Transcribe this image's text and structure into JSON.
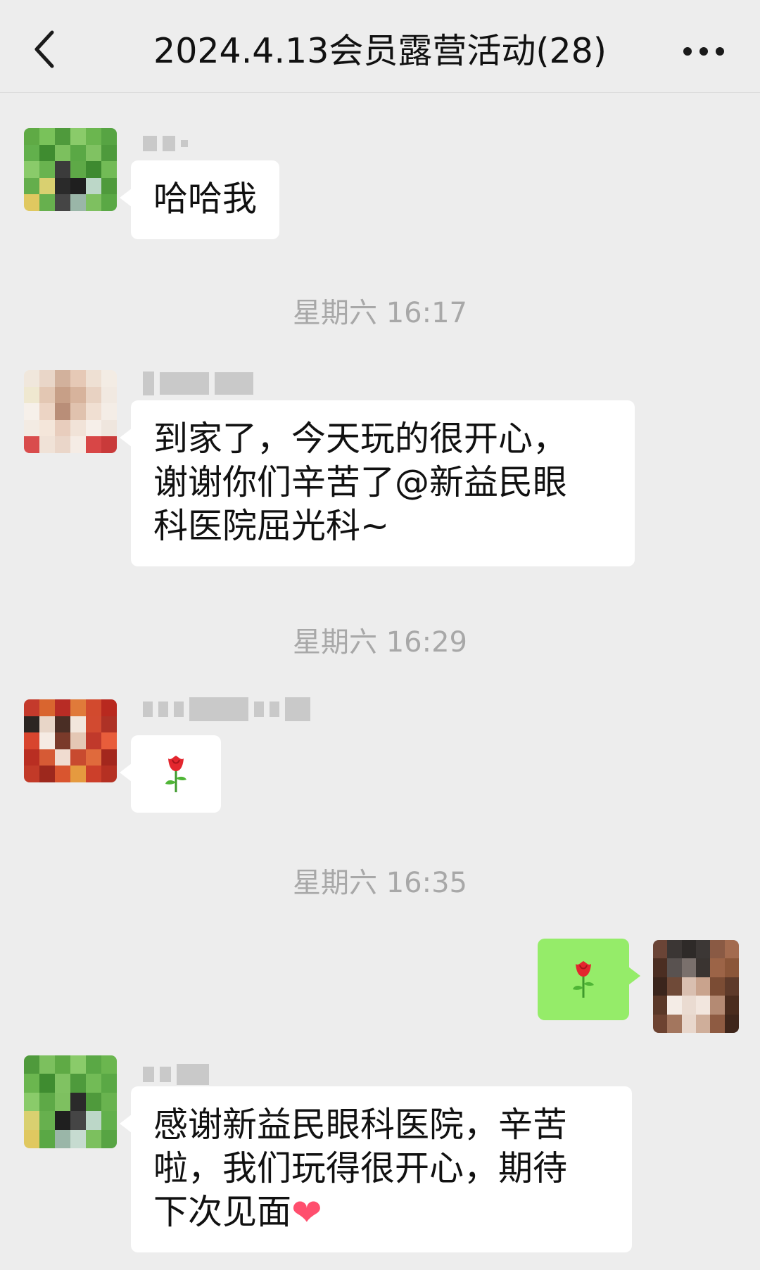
{
  "header": {
    "title": "2024.4.13会员露营活动(28)",
    "back_icon": "chevron-left-icon",
    "more_icon": "ellipsis-icon"
  },
  "messages": [
    {
      "type": "text",
      "sender": "other",
      "text": "哈哈我"
    },
    {
      "type": "timestamp",
      "text": "星期六 16:17"
    },
    {
      "type": "text",
      "sender": "other",
      "lines": [
        "到家了，今天玩的很开心，",
        "谢谢你们辛苦了@新益民眼",
        "科医院屈光科~"
      ]
    },
    {
      "type": "timestamp",
      "text": "星期六 16:29"
    },
    {
      "type": "emoji",
      "sender": "other",
      "emoji": "rose"
    },
    {
      "type": "timestamp",
      "text": "星期六 16:35"
    },
    {
      "type": "emoji",
      "sender": "me",
      "emoji": "rose"
    },
    {
      "type": "text",
      "sender": "other",
      "lines": [
        "感谢新益民眼科医院，辛苦",
        "啦，我们玩得很开心，期待",
        "下次见面"
      ],
      "trailing_emoji": "heart"
    }
  ],
  "colors": {
    "background": "#ededed",
    "bubble_other": "#ffffff",
    "bubble_me": "#95ec69",
    "timestamp": "#a8a8a8"
  }
}
